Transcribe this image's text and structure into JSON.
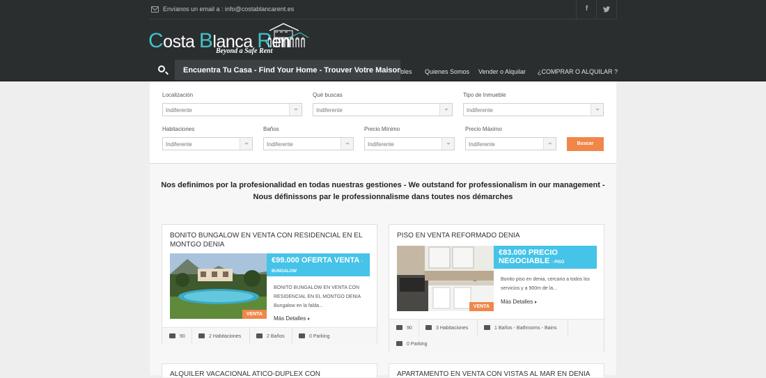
{
  "topbar": {
    "email_text": "Envíanos un email a : info@costablancarent.es",
    "facebook": "f",
    "twitter": "t"
  },
  "logo": {
    "brand_c": "C",
    "brand_1": "osta ",
    "brand_b": "B",
    "brand_2": "lanca ",
    "brand_r": "R",
    "brand_3": "en",
    "tagline": "Beyond a Safe Rent"
  },
  "search": {
    "text": "Encuentra Tu Casa - Find Your Home - Trouver Votre Maison"
  },
  "nav": {
    "items": [
      "bles",
      "Quienes Somos",
      "Vender o Alquilar",
      "¿COMPRAR O ALQUILAR ?"
    ]
  },
  "filters": {
    "localizacion": {
      "label": "Localización",
      "value": "Indiferente"
    },
    "que_buscas": {
      "label": "Qué buscas",
      "value": "Indiferente"
    },
    "tipo": {
      "label": "Tipo de Inmueble",
      "value": "Indiferente"
    },
    "habitaciones": {
      "label": "Habitaciones",
      "value": "Indiferente"
    },
    "banos": {
      "label": "Baños",
      "value": "Indiferente"
    },
    "precio_min": {
      "label": "Precio Mínimo",
      "value": "Indiferente"
    },
    "precio_max": {
      "label": "Precio Máximo",
      "value": "Indiferente"
    },
    "buscar": "Buscar"
  },
  "slogan": {
    "line1": "Nos definimos por la profesionalidad en todas nuestras gestiones - We outstand for professionalism in our management -",
    "line2": "Nous définissons par le professionnalisme dans toutes nos démarches"
  },
  "listings": [
    {
      "title": "BONITO BUNGALOW EN VENTA CON RESIDENCIAL EN EL MONTGO DENIA",
      "price": "€99.000 OFERTA VENTA",
      "type": "- BUNGALOW",
      "badge": "VENTA",
      "desc": "BONITO BUNGALOW EN VENTA CON RESIDENCIAL EN EL MONTGO  DENIA Bungalow en la falda...",
      "more": "Más Detalles",
      "features": [
        "90",
        "2 Habitaciones",
        "2 Baños",
        "0 Parking"
      ]
    },
    {
      "title": "PISO EN VENTA REFORMADO DENIA",
      "price": "€83.000 PRECIO NEGOCIABLE",
      "type": "- PISO",
      "badge": "VENTA",
      "desc": "Bonito piso en denia, cercano a todos los servicios y a 900m de la...",
      "more": "Más Detalles",
      "features": [
        "90",
        "3 Habitaciones",
        "1 Baños - Bathrooms - Bains",
        "0 Parking"
      ]
    }
  ],
  "next_listings": [
    "ALQUILER VACACIONAL ATICO-DUPLEX CON",
    "APARTAMENTO EN VENTA CON VISTAS AL MAR EN DENIA"
  ],
  "colors": {
    "header": "#2b2e2f",
    "accent_teal": "#3fc1c7",
    "price_blue": "#45c3e8",
    "button_orange": "#f0864a"
  }
}
